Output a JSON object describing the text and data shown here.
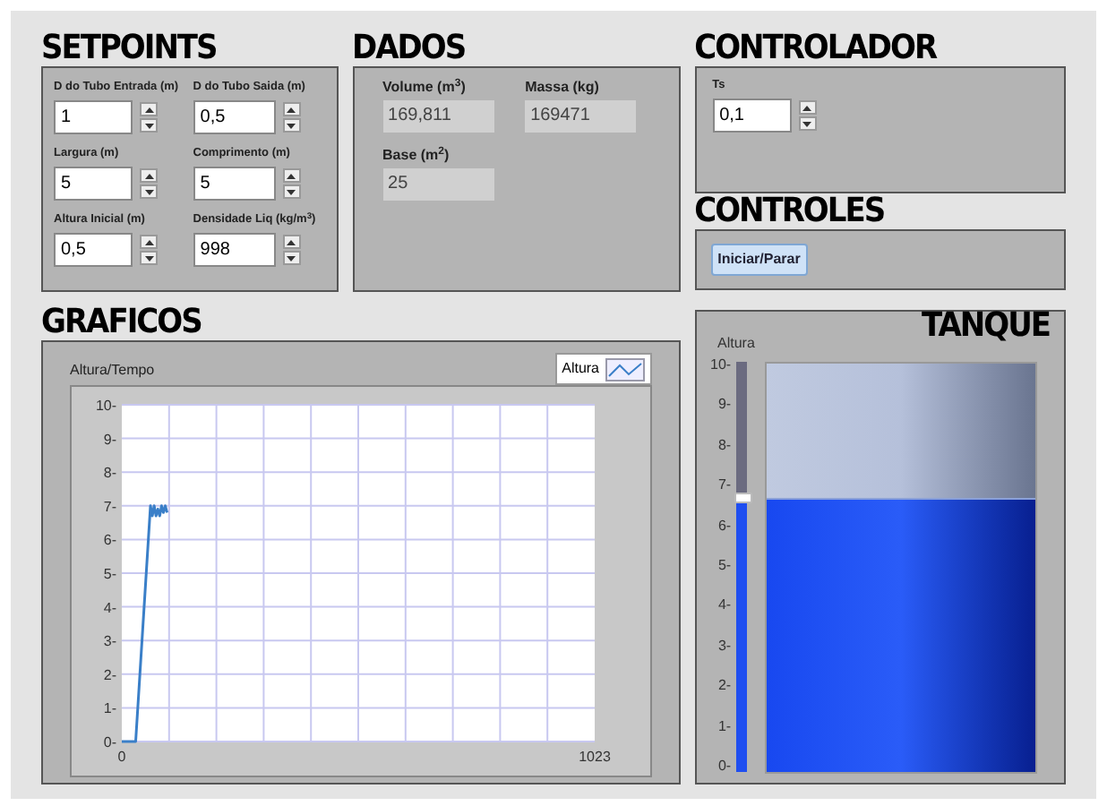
{
  "setpoints": {
    "title": "SETPOINTS",
    "fields": [
      {
        "label": "D do Tubo Entrada (m)",
        "value": "1"
      },
      {
        "label": "D do Tubo Saida (m)",
        "value": "0,5"
      },
      {
        "label": "Largura (m)",
        "value": "5"
      },
      {
        "label": "Comprimento (m)",
        "value": "5"
      },
      {
        "label": "Altura Inicial (m)",
        "value": "0,5"
      },
      {
        "label": "Densidade Liq (kg/m$^{3}$)",
        "value": "998"
      }
    ]
  },
  "dados": {
    "title": "DADOS",
    "indicators": [
      {
        "label": "Volume (m$^{3}$)",
        "value": "169,811"
      },
      {
        "label": "Massa (kg)",
        "value": "169471"
      },
      {
        "label": "Base (m$^{2}$)",
        "value": "25"
      }
    ]
  },
  "controlador": {
    "title": "CONTROLADOR",
    "fields": [
      {
        "label": "Ts",
        "value": "0,1"
      }
    ]
  },
  "controles": {
    "title": "CONTROLES",
    "button": "Iniciar/Parar"
  },
  "graficos": {
    "title": "GRAFICOS",
    "chart_data": {
      "type": "line",
      "title": "Altura/Tempo",
      "x": [
        0,
        30,
        62,
        66,
        70,
        74,
        78,
        82,
        86,
        90,
        94,
        98
      ],
      "series": [
        {
          "name": "Altura",
          "color": "#3a7fc8",
          "values": [
            0,
            0,
            7,
            6.7,
            7,
            6.7,
            6.9,
            6.7,
            7,
            6.8,
            7,
            6.8
          ]
        }
      ],
      "xlim": [
        0,
        1023
      ],
      "ylim": [
        0,
        10
      ],
      "grid": true,
      "xticks": [
        0,
        1023
      ],
      "yticks": [
        {
          "value": 0,
          "label": "0-"
        },
        {
          "value": 1,
          "label": "1-"
        },
        {
          "value": 2,
          "label": "2-"
        },
        {
          "value": 3,
          "label": "3-"
        },
        {
          "value": 4,
          "label": "4-"
        },
        {
          "value": 5,
          "label": "5-"
        },
        {
          "value": 6,
          "label": "6-"
        },
        {
          "value": 7,
          "label": "7-"
        },
        {
          "value": 8,
          "label": "8-"
        },
        {
          "value": 9,
          "label": "9-"
        },
        {
          "value": 10,
          "label": "10-"
        }
      ]
    }
  },
  "tanque": {
    "title": "TANQUE",
    "scale_label": "Altura",
    "scale_ticks": [
      "10-",
      "9-",
      "8-",
      "7-",
      "6-",
      "5-",
      "4-",
      "3-",
      "2-",
      "1-",
      "0-"
    ],
    "slider": {
      "level": 0.67
    },
    "tank": {
      "level": 0.67
    }
  }
}
